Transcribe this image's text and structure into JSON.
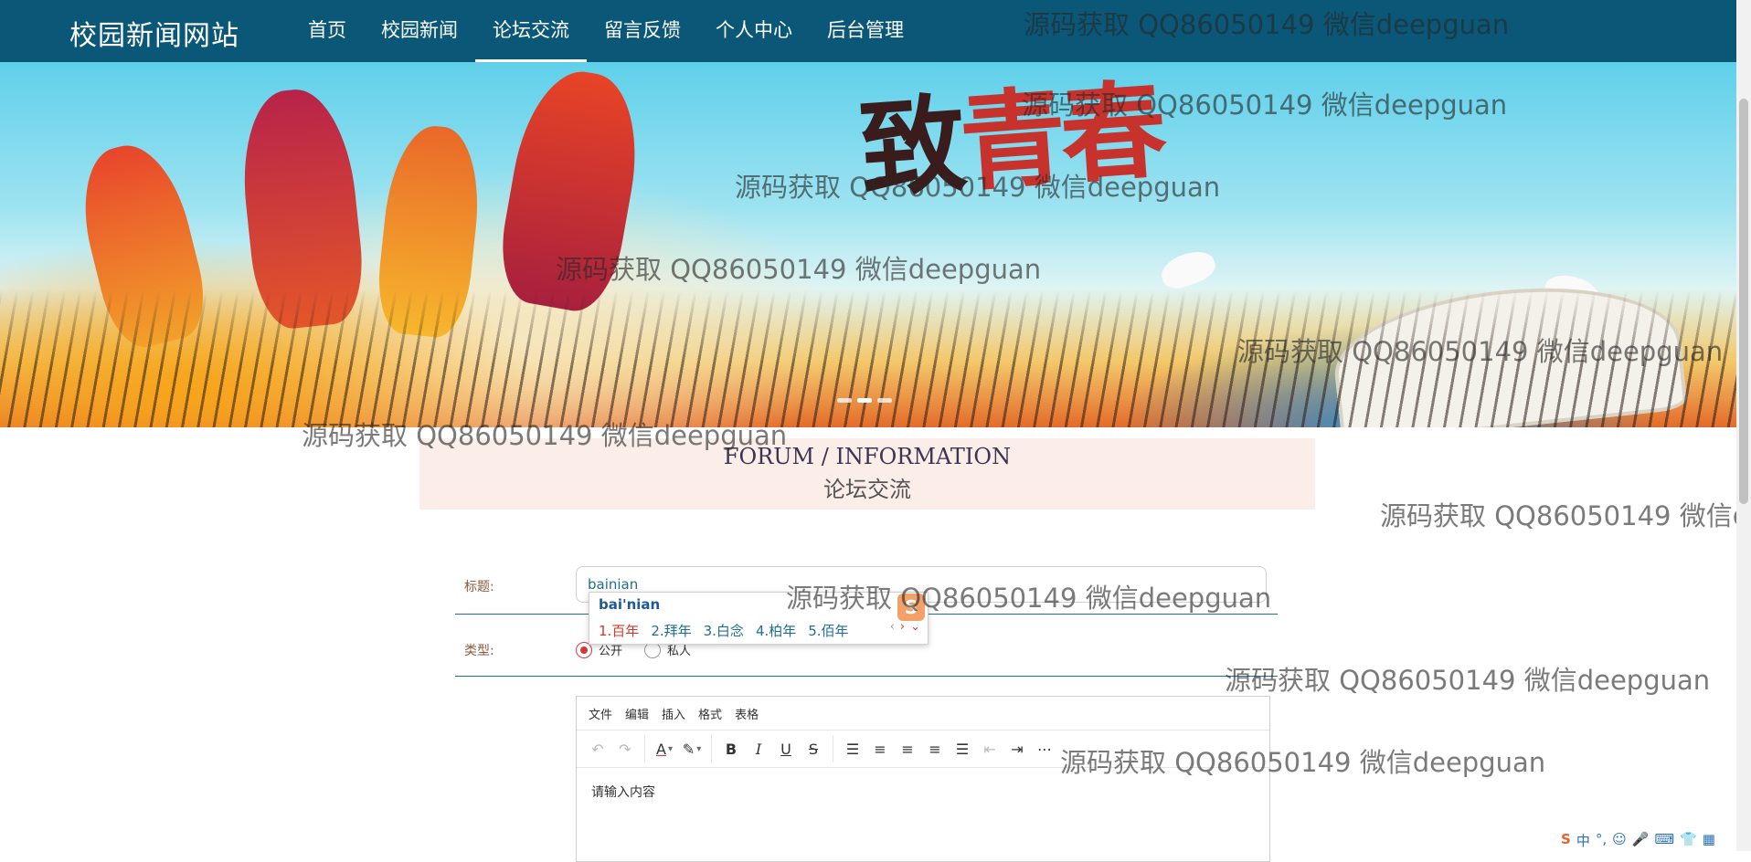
{
  "site": {
    "name": "校园新闻网站"
  },
  "nav": {
    "items": [
      {
        "label": "首页"
      },
      {
        "label": "校园新闻"
      },
      {
        "label": "论坛交流"
      },
      {
        "label": "留言反馈"
      },
      {
        "label": "个人中心"
      },
      {
        "label": "后台管理"
      }
    ],
    "active": "论坛交流"
  },
  "banner": {
    "title_part1": "致",
    "title_part2": "青",
    "title_part3": "春"
  },
  "section": {
    "title_en": "FORUM / INFORMATION",
    "title_cn": "论坛交流"
  },
  "form": {
    "title_label": "标题:",
    "title_value": "bainian",
    "type_label": "类型:",
    "type_options": [
      {
        "label": "公开",
        "checked": true
      },
      {
        "label": "私人",
        "checked": false
      }
    ]
  },
  "ime": {
    "composition": "bai'nian",
    "candidates": [
      "1.百年",
      "2.拜年",
      "3.白念",
      "4.柏年",
      "5.佰年"
    ]
  },
  "editor": {
    "menu": [
      "文件",
      "编辑",
      "插入",
      "格式",
      "表格"
    ],
    "placeholder": "请输入内容"
  },
  "watermark": {
    "text": "源码获取 QQ86050149 微信deepguan"
  },
  "colors": {
    "header": "#0a5777",
    "section_bg": "#fbeee8",
    "accent_red": "#d13b3b",
    "form_line": "#1e6f8f"
  }
}
